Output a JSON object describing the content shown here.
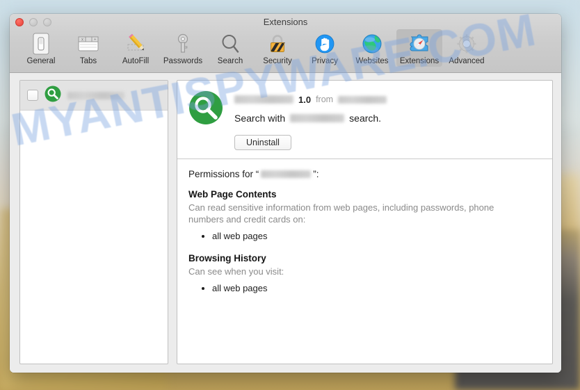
{
  "window": {
    "title": "Extensions",
    "traffic_lights": [
      "close-button",
      "minimize-button",
      "zoom-button"
    ]
  },
  "toolbar": {
    "items": [
      {
        "label": "General",
        "icon": "general-icon",
        "selected": false
      },
      {
        "label": "Tabs",
        "icon": "tabs-icon",
        "selected": false
      },
      {
        "label": "AutoFill",
        "icon": "autofill-icon",
        "selected": false
      },
      {
        "label": "Passwords",
        "icon": "passwords-icon",
        "selected": false
      },
      {
        "label": "Search",
        "icon": "search-icon",
        "selected": false
      },
      {
        "label": "Security",
        "icon": "security-icon",
        "selected": false
      },
      {
        "label": "Privacy",
        "icon": "privacy-icon",
        "selected": false
      },
      {
        "label": "Websites",
        "icon": "websites-icon",
        "selected": false
      },
      {
        "label": "Extensions",
        "icon": "extensions-icon",
        "selected": true
      },
      {
        "label": "Advanced",
        "icon": "advanced-icon",
        "selected": false
      }
    ]
  },
  "extension_list": {
    "items": [
      {
        "checked": false,
        "icon": "green-magnifier-icon",
        "name_redacted": true,
        "name_block_width": 82
      }
    ]
  },
  "detail": {
    "icon": "green-magnifier-icon",
    "name_redacted": true,
    "name_block_width": 85,
    "version": "1.0",
    "from_label": "from",
    "publisher_redacted": true,
    "publisher_block_width": 70,
    "description_prefix": "Search with",
    "description_name_redacted": true,
    "description_block_width": 78,
    "description_suffix": "search.",
    "uninstall_label": "Uninstall"
  },
  "permissions": {
    "heading_prefix": "Permissions for “",
    "heading_name_redacted": true,
    "heading_block_width": 72,
    "heading_suffix": "”:",
    "groups": [
      {
        "title": "Web Page Contents",
        "description": "Can read sensitive information from web pages, including passwords, phone numbers and credit cards on:",
        "bullets": [
          "all web pages"
        ]
      },
      {
        "title": "Browsing History",
        "description": "Can see when you visit:",
        "bullets": [
          "all web pages"
        ]
      }
    ]
  },
  "watermark": {
    "text": "MYANTISPYWARE.COM"
  },
  "colors": {
    "extension_icon_green": "#2f9e41",
    "selected_toolbar_item": "#bcbcbc",
    "window_chrome": "#ececec",
    "watermark_blue": "#76a0de"
  }
}
